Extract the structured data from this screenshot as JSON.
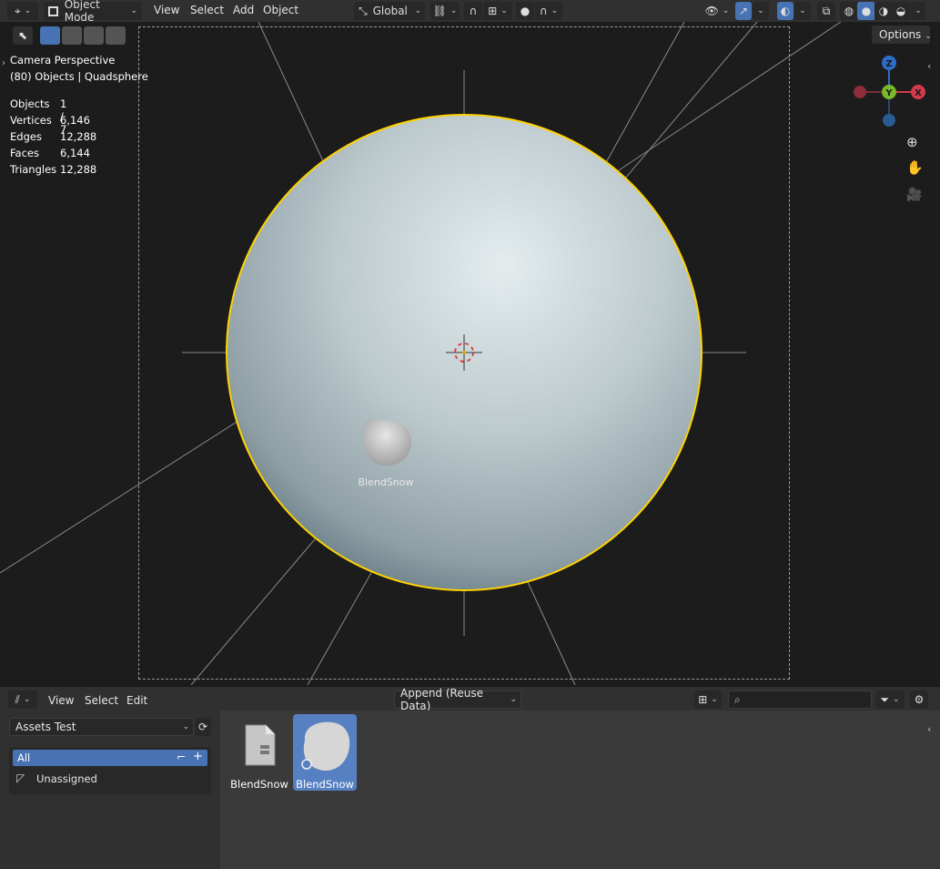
{
  "header": {
    "mode": "Object Mode",
    "menus": [
      "View",
      "Select",
      "Add",
      "Object"
    ],
    "orientation": "Global"
  },
  "viewport": {
    "camera_label": "Camera Perspective",
    "object_info": "(80) Objects | Quadsphere",
    "options_label": "Options",
    "stats": [
      {
        "label": "Objects",
        "value": "1 / 7"
      },
      {
        "label": "Vertices",
        "value": "6,146"
      },
      {
        "label": "Edges",
        "value": "12,288"
      },
      {
        "label": "Faces",
        "value": "6,144"
      },
      {
        "label": "Triangles",
        "value": "12,288"
      }
    ],
    "drag_label": "BlendSnow",
    "gizmo_axes": {
      "z": "Z",
      "y": "Y",
      "x": "X"
    },
    "accent_color": "#ffd200"
  },
  "file_browser": {
    "menus": [
      "View",
      "Select",
      "Edit"
    ],
    "import_method": "Append (Reuse Data)",
    "search_placeholder": "",
    "library": "Assets Test",
    "catalogs": [
      {
        "label": "All",
        "selected": true
      },
      {
        "label": "Unassigned",
        "selected": false
      }
    ],
    "assets": [
      {
        "label": "BlendSnow",
        "selected": false,
        "icon": "blend-file-icon"
      },
      {
        "label": "BlendSnow",
        "selected": true,
        "icon": "snowball-preview"
      }
    ]
  }
}
